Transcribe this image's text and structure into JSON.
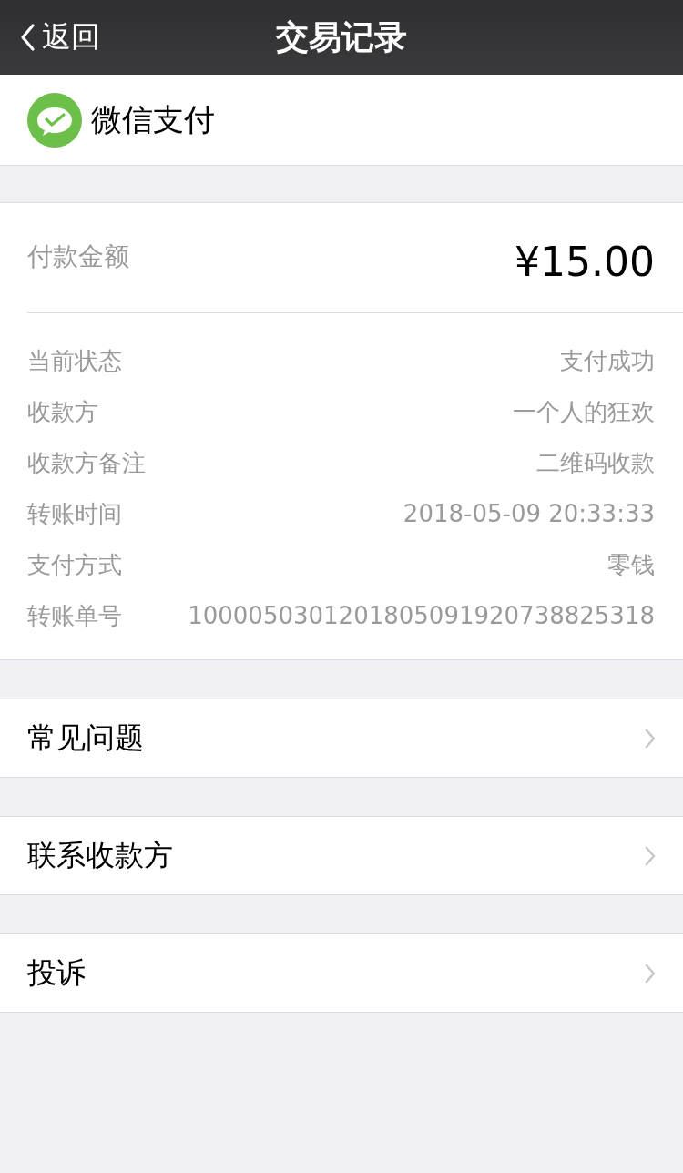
{
  "nav_bar": {
    "back_label": "返回",
    "title": "交易记录"
  },
  "merchant": {
    "name": "微信支付"
  },
  "payment": {
    "amount_label": "付款金额",
    "amount": "¥15.00",
    "details": [
      {
        "label": "当前状态",
        "value": "支付成功"
      },
      {
        "label": "收款方",
        "value": "一个人的狂欢"
      },
      {
        "label": "收款方备注",
        "value": "二维码收款"
      },
      {
        "label": "转账时间",
        "value": "2018-05-09 20:33:33"
      },
      {
        "label": "支付方式",
        "value": "零钱"
      },
      {
        "label": "转账单号",
        "value": "1000050301201805091920738825318"
      }
    ]
  },
  "menu": [
    {
      "label": "常见问题"
    },
    {
      "label": "联系收款方"
    },
    {
      "label": "投诉"
    }
  ]
}
